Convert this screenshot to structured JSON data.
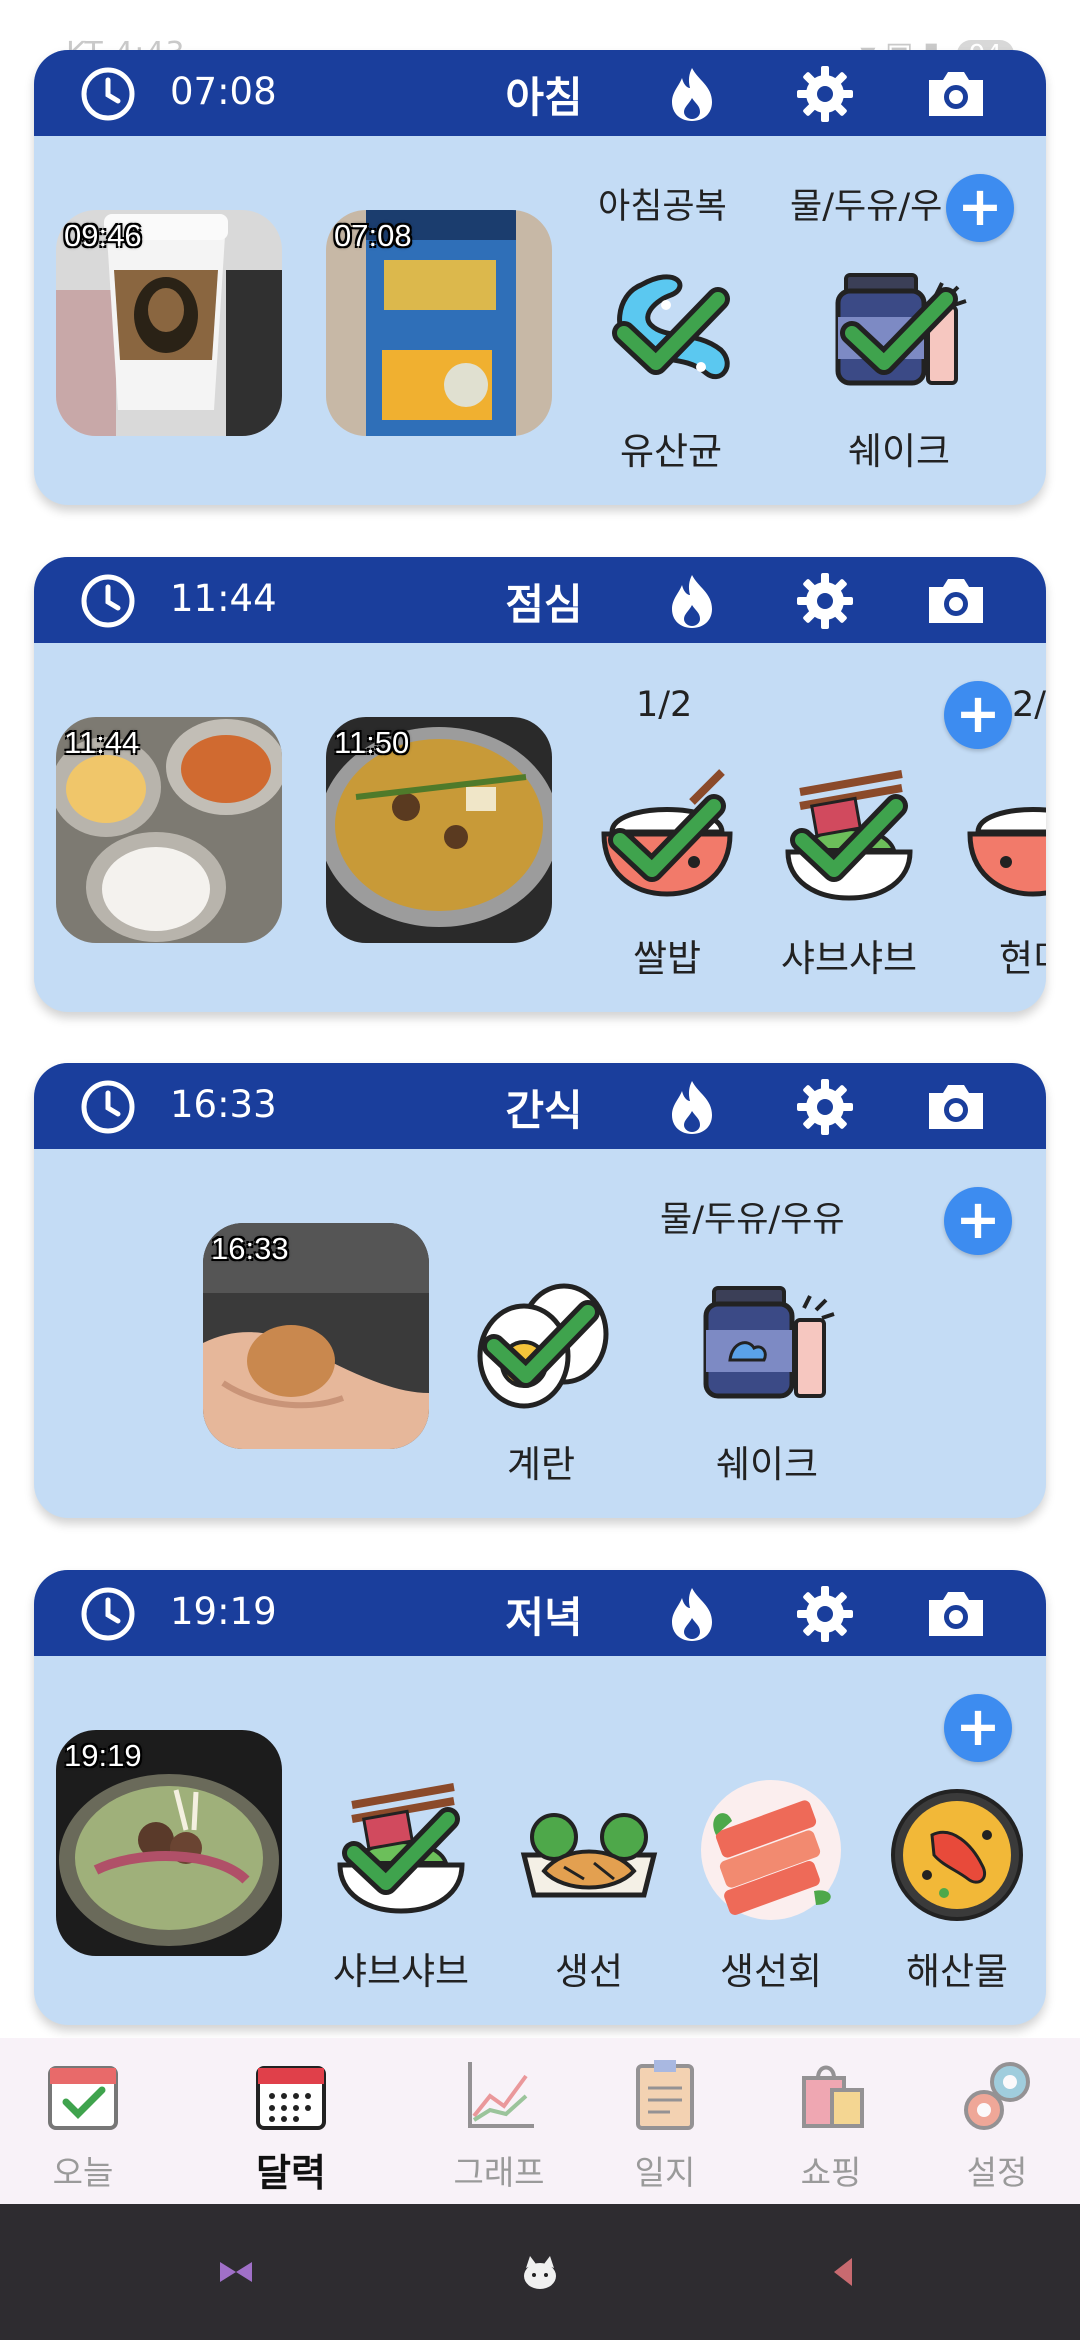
{
  "status_bar": {
    "carrier": "KT 4:43",
    "battery": "94"
  },
  "meals": [
    {
      "time": "07:08",
      "title": "아침",
      "photos": [
        {
          "time": "09:46"
        },
        {
          "time": "07:08"
        }
      ],
      "groups": [
        "아침공복",
        "물/두유/우"
      ],
      "items": [
        {
          "label": "유산균",
          "icon": "probiotic-icon"
        },
        {
          "label": "쉐이크",
          "icon": "shake-icon"
        }
      ]
    },
    {
      "time": "11:44",
      "title": "점심",
      "photos": [
        {
          "time": "11:44"
        },
        {
          "time": "11:50"
        }
      ],
      "groups": [
        "1/2",
        "2/"
      ],
      "items": [
        {
          "label": "쌀밥",
          "icon": "rice-bowl-icon"
        },
        {
          "label": "샤브샤브",
          "icon": "shabu-icon"
        },
        {
          "label": "현미",
          "icon": "brown-rice-icon"
        }
      ]
    },
    {
      "time": "16:33",
      "title": "간식",
      "photos": [
        {
          "time": "16:33"
        }
      ],
      "groups": [
        "물/두유/우유"
      ],
      "items": [
        {
          "label": "계란",
          "icon": "egg-icon"
        },
        {
          "label": "쉐이크",
          "icon": "shake-icon"
        }
      ]
    },
    {
      "time": "19:19",
      "title": "저녁",
      "photos": [
        {
          "time": "19:19"
        }
      ],
      "groups": [],
      "items": [
        {
          "label": "샤브샤브",
          "icon": "shabu-icon"
        },
        {
          "label": "생선",
          "icon": "fish-icon"
        },
        {
          "label": "생선회",
          "icon": "sashimi-icon"
        },
        {
          "label": "해산물",
          "icon": "seafood-icon"
        }
      ]
    }
  ],
  "add_symbol": "+",
  "bottom_nav": [
    {
      "label": "오늘",
      "icon": "today-calendar-icon"
    },
    {
      "label": "달력",
      "icon": "calendar-icon",
      "active": true
    },
    {
      "label": "그래프",
      "icon": "graph-icon"
    },
    {
      "label": "일지",
      "icon": "journal-icon"
    },
    {
      "label": "쇼핑",
      "icon": "shopping-bag-icon"
    },
    {
      "label": "설정",
      "icon": "settings-gears-icon"
    }
  ],
  "colors": {
    "header": "#1a3e9c",
    "card": "#c4dcf5",
    "accent": "#3d8cf0",
    "check": "#3fa34d"
  }
}
